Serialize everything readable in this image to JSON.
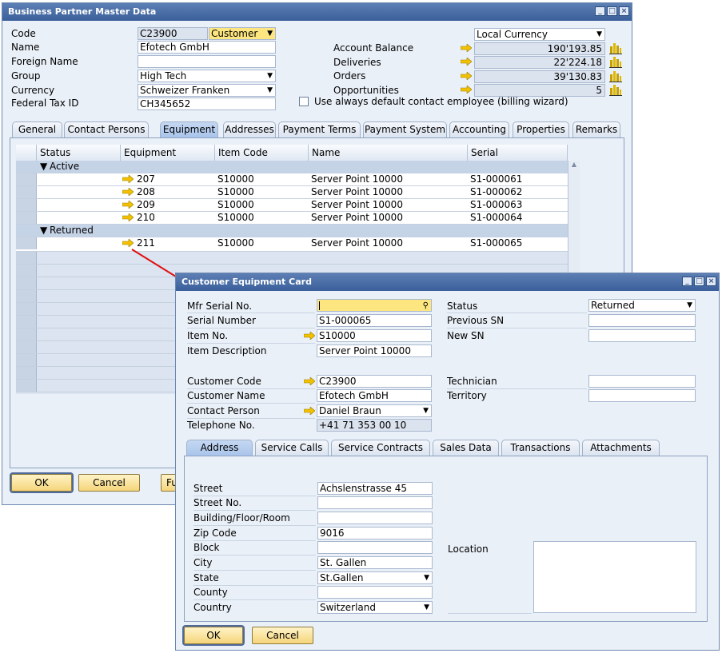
{
  "bp": {
    "title": "Business Partner Master Data",
    "fields": {
      "code_label": "Code",
      "code": "C23900",
      "type": "Customer",
      "name_label": "Name",
      "name": "Efotech GmbH",
      "foreign_label": "Foreign Name",
      "foreign": "",
      "group_label": "Group",
      "group": "High Tech",
      "currency_label": "Currency",
      "currency": "Schweizer Franken",
      "taxid_label": "Federal Tax ID",
      "taxid": "CH345652"
    },
    "right": {
      "currency_select": "Local Currency",
      "balance_label": "Account Balance",
      "balance": "190'193.85",
      "deliveries_label": "Deliveries",
      "deliveries": "22'224.18",
      "orders_label": "Orders",
      "orders": "39'130.83",
      "opps_label": "Opportunities",
      "opps": "5",
      "billing_label": "Use always default contact employee (billing wizard)"
    },
    "tabs": [
      "General",
      "Contact Persons",
      "Equipment",
      "Addresses",
      "Payment Terms",
      "Payment System",
      "Accounting",
      "Properties",
      "Remarks"
    ],
    "grid": {
      "headers": [
        "Status",
        "Equipment",
        "Item Code",
        "Name",
        "Serial"
      ],
      "group_active": "Active",
      "group_returned": "Returned",
      "rows": [
        {
          "equipment": "207",
          "item": "S10000",
          "name": "Server Point 10000",
          "serial": "S1-000061"
        },
        {
          "equipment": "208",
          "item": "S10000",
          "name": "Server Point 10000",
          "serial": "S1-000062"
        },
        {
          "equipment": "209",
          "item": "S10000",
          "name": "Server Point 10000",
          "serial": "S1-000063"
        },
        {
          "equipment": "210",
          "item": "S10000",
          "name": "Server Point 10000",
          "serial": "S1-000064"
        },
        {
          "equipment": "211",
          "item": "S10000",
          "name": "Server Point 10000",
          "serial": "S1-000065"
        }
      ]
    },
    "buttons": {
      "ok": "OK",
      "cancel": "Cancel",
      "fu": "Fu"
    }
  },
  "card": {
    "title": "Customer Equipment Card",
    "left": {
      "mfr_label": "Mfr Serial No.",
      "mfr": "",
      "serial_label": "Serial Number",
      "serial": "S1-000065",
      "item_label": "Item No.",
      "item": "S10000",
      "desc_label": "Item Description",
      "desc": "Server Point 10000",
      "cust_code_label": "Customer Code",
      "cust_code": "C23900",
      "cust_name_label": "Customer Name",
      "cust_name": "Efotech GmbH",
      "contact_label": "Contact Person",
      "contact": "Daniel Braun",
      "phone_label": "Telephone No.",
      "phone": "+41 71 353 00 10"
    },
    "right": {
      "status_label": "Status",
      "status": "Returned",
      "prev_label": "Previous SN",
      "prev": "",
      "new_label": "New SN",
      "new": "",
      "tech_label": "Technician",
      "tech": "",
      "territory_label": "Territory",
      "territory": ""
    },
    "tabs": [
      "Address",
      "Service Calls",
      "Service Contracts",
      "Sales Data",
      "Transactions",
      "Attachments"
    ],
    "address": {
      "street_label": "Street",
      "street": "Achslenstrasse 45",
      "streetno_label": "Street No.",
      "streetno": "",
      "building_label": "Building/Floor/Room",
      "building": "",
      "zip_label": "Zip Code",
      "zip": "9016",
      "block_label": "Block",
      "block": "",
      "city_label": "City",
      "city": "St. Gallen",
      "state_label": "State",
      "state": "St.Gallen",
      "county_label": "County",
      "county": "",
      "country_label": "Country",
      "country": "Switzerland",
      "location_label": "Location"
    },
    "buttons": {
      "ok": "OK",
      "cancel": "Cancel"
    }
  },
  "colors": {
    "accent": "#3a5f9a",
    "arrow": "#f2c200",
    "link_line": "#e01010"
  }
}
